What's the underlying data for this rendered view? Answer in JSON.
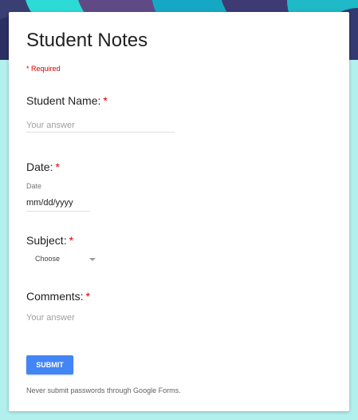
{
  "form": {
    "title": "Student Notes",
    "required_note": "* Required",
    "footer_note": "Never submit passwords through Google Forms.",
    "submit_label": "SUBMIT",
    "required_mark": "*"
  },
  "questions": {
    "student_name": {
      "label": "Student Name:",
      "placeholder": "Your answer"
    },
    "date": {
      "label": "Date:",
      "sub_label": "Date",
      "value": "mm/dd/yyyy"
    },
    "subject": {
      "label": "Subject:",
      "selected": "Choose"
    },
    "comments": {
      "label": "Comments:",
      "placeholder": "Your answer"
    }
  },
  "colors": {
    "background": "#b2f0ee",
    "accent_button": "#4285f4",
    "required": "#d50000"
  },
  "icons": {
    "dropdown": "triangle-down-icon"
  }
}
